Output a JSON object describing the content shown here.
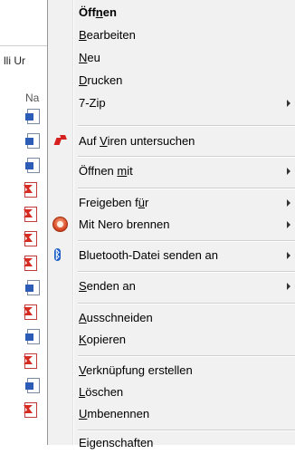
{
  "explorer": {
    "breadcrumb_fragment": "lli Ur",
    "column_fragment": "Na",
    "files": [
      {
        "type": "word"
      },
      {
        "type": "word"
      },
      {
        "type": "word"
      },
      {
        "type": "pdf"
      },
      {
        "type": "pdf"
      },
      {
        "type": "pdf"
      },
      {
        "type": "pdf"
      },
      {
        "type": "word"
      },
      {
        "type": "pdf"
      },
      {
        "type": "word"
      },
      {
        "type": "pdf"
      },
      {
        "type": "word"
      },
      {
        "type": "pdf"
      }
    ]
  },
  "context_menu": {
    "items": [
      {
        "pre": "Öff",
        "u": "n",
        "post": "en",
        "bold": true
      },
      {
        "pre": "",
        "u": "B",
        "post": "earbeiten"
      },
      {
        "pre": "",
        "u": "N",
        "post": "eu"
      },
      {
        "pre": "",
        "u": "D",
        "post": "rucken"
      },
      {
        "pre": "7-Zip",
        "u": "",
        "post": "",
        "submenu": true
      },
      {
        "pre": "Auf ",
        "u": "V",
        "post": "iren untersuchen",
        "icon": "antivirus-icon"
      },
      {
        "pre": "Öffnen ",
        "u": "m",
        "post": "it",
        "submenu": true
      },
      {
        "pre": "Freigeben f",
        "u": "ü",
        "post": "r",
        "submenu": true
      },
      {
        "pre": "Mit Nero brennen",
        "u": "",
        "post": "",
        "submenu": true,
        "icon": "nero-icon"
      },
      {
        "pre": "Bluetooth-Datei senden an",
        "u": "",
        "post": "",
        "submenu": true,
        "icon": "bluetooth-icon"
      },
      {
        "pre": "",
        "u": "S",
        "post": "enden an",
        "submenu": true
      },
      {
        "pre": "",
        "u": "A",
        "post": "usschneiden"
      },
      {
        "pre": "",
        "u": "K",
        "post": "opieren"
      },
      {
        "pre": "",
        "u": "V",
        "post": "erknüpfung erstellen"
      },
      {
        "pre": "",
        "u": "L",
        "post": "öschen"
      },
      {
        "pre": "",
        "u": "U",
        "post": "mbenennen"
      },
      {
        "pre": "Ei",
        "u": "g",
        "post": "enschaften"
      }
    ],
    "colors": {
      "background": "#f1f1f1",
      "border": "#979797",
      "separator": "#cfcfcf"
    }
  }
}
